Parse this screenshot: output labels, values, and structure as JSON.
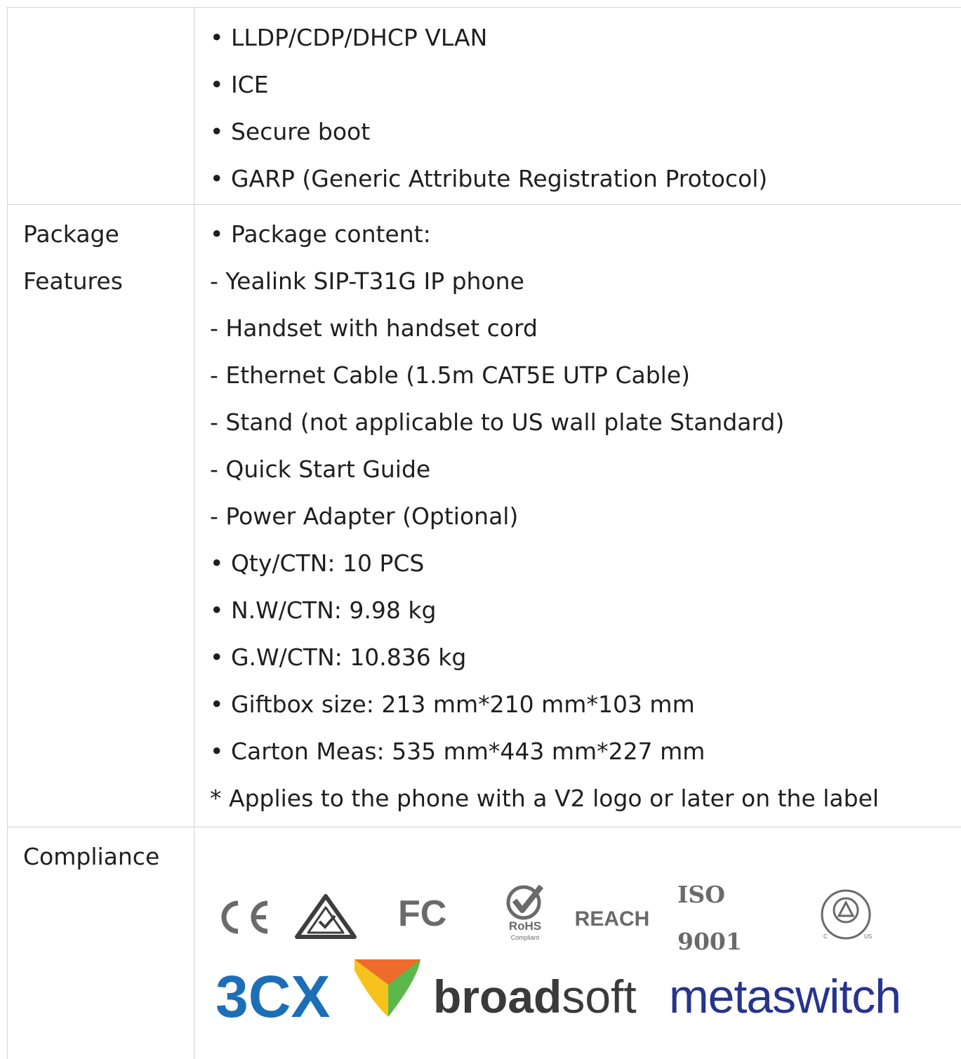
{
  "rows": [
    {
      "label_lines": [],
      "lines": [
        "• LLDP/CDP/DHCP VLAN",
        "• ICE",
        "• Secure boot",
        "• GARP (Generic Attribute Registration Protocol)"
      ]
    },
    {
      "label_lines": [
        "Package",
        "Features"
      ],
      "lines": [
        "• Package content:",
        "- Yealink SIP-T31G IP phone",
        "- Handset with handset cord",
        "- Ethernet Cable (1.5m CAT5E UTP Cable)",
        "- Stand (not applicable to US wall plate Standard)",
        "- Quick Start Guide",
        "- Power Adapter (Optional)",
        "• Qty/CTN: 10 PCS",
        "• N.W/CTN: 9.98 kg",
        "• G.W/CTN: 10.836 kg",
        "• Giftbox size: 213 mm*210 mm*103 mm",
        "• Carton Meas: 535 mm*443 mm*227 mm",
        "* Applies to the phone with a V2 logo or later on the label"
      ]
    },
    {
      "label_lines": [
        "Compliance"
      ],
      "logos": {
        "ce": "CE",
        "fc": "FC",
        "rohs": "RoHS",
        "rohs_sub": "Compliant",
        "reach": "REACH",
        "iso": "ISO 9001",
        "tuv_c": "C",
        "tuv_us": "US",
        "threecx": "3CX",
        "broad": "broad",
        "soft": "soft",
        "metaswitch": "metaswitch"
      }
    }
  ],
  "colors": {
    "border": "#d4d4d4",
    "logo_gray": "#6a6a6a",
    "threecx_blue": "#1c6fb7",
    "broadsoft_dark": "#3a3a3a",
    "metaswitch_blue": "#26348c"
  }
}
